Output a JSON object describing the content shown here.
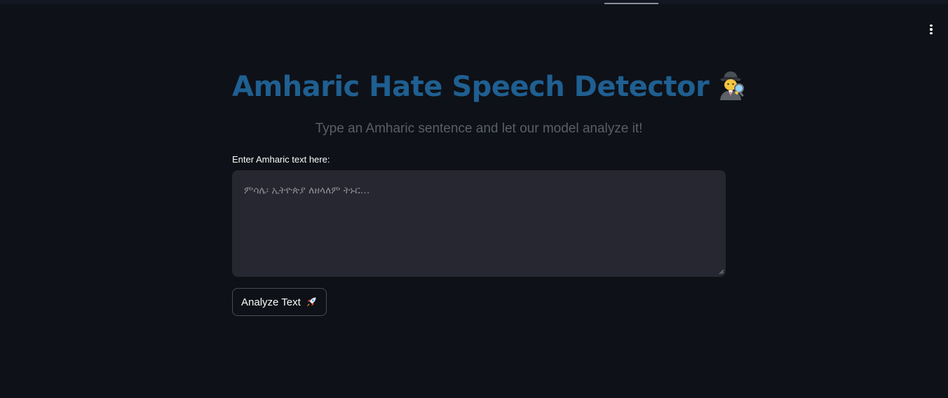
{
  "app": {
    "title": "Amharic Hate Speech Detector",
    "title_icon": "detective-icon",
    "subtitle": "Type an Amharic sentence and let our model analyze it!"
  },
  "input": {
    "label": "Enter Amharic text here:",
    "placeholder": "ምሳሌ፡ ኢትዮጵያ ለዘላለም ትኑር...",
    "value": ""
  },
  "actions": {
    "analyze_label": "Analyze Text",
    "analyze_icon": "rocket-icon"
  },
  "menu": {
    "icon": "more-vertical-icon"
  },
  "colors": {
    "background": "#0e1117",
    "title": "#1f5f91",
    "subtitle": "#5b5f66",
    "input_background": "#262730"
  }
}
